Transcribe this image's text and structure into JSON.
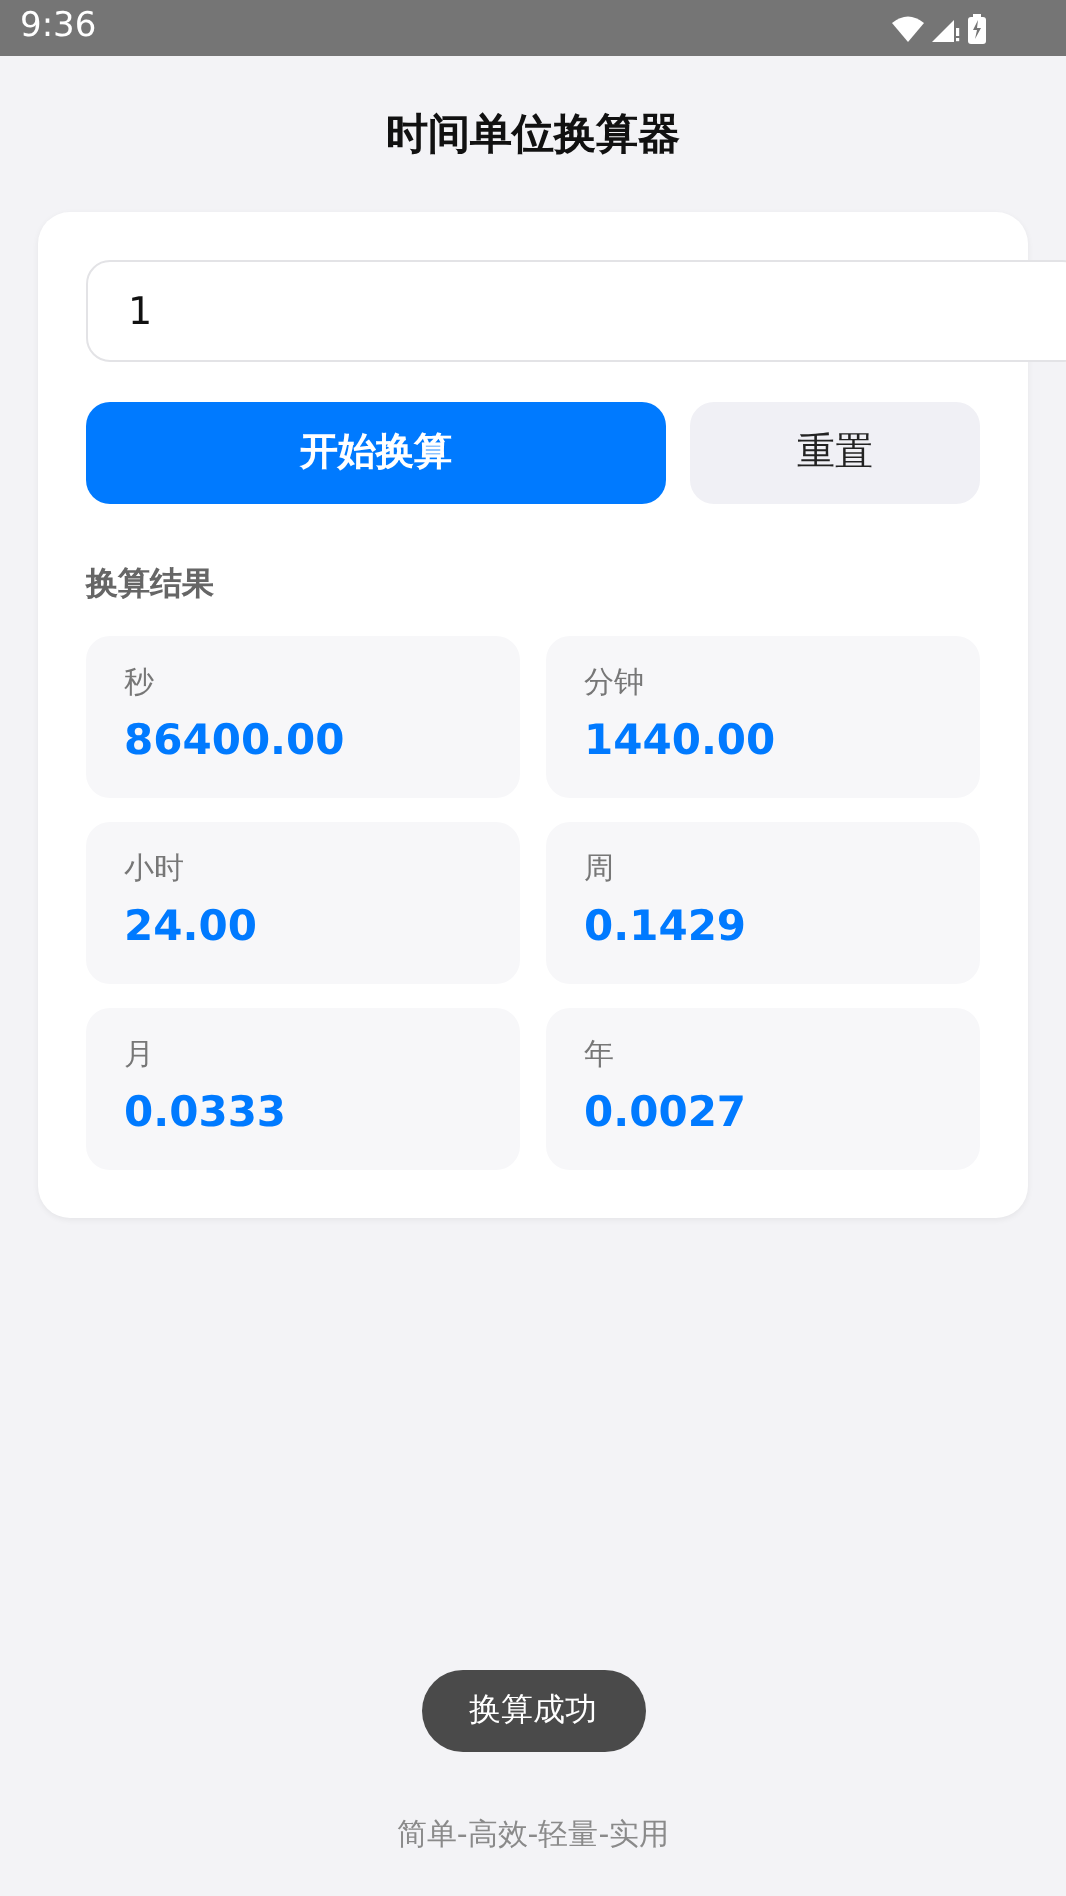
{
  "status_bar": {
    "time": "9:36"
  },
  "title": "时间单位换算器",
  "input": {
    "value": "1"
  },
  "buttons": [
    {
      "label": "开始换算",
      "kind": "primary"
    },
    {
      "label": "重置",
      "kind": "secondary"
    }
  ],
  "results": {
    "heading": "换算结果",
    "items": [
      {
        "unit": "秒",
        "value": "86400.00"
      },
      {
        "unit": "分钟",
        "value": "1440.00"
      },
      {
        "unit": "小时",
        "value": "24.00"
      },
      {
        "unit": "周",
        "value": "0.1429"
      },
      {
        "unit": "月",
        "value": "0.0333"
      },
      {
        "unit": "年",
        "value": "0.0027"
      }
    ]
  },
  "toast": "换算成功",
  "footer": "简单-高效-轻量-实用"
}
